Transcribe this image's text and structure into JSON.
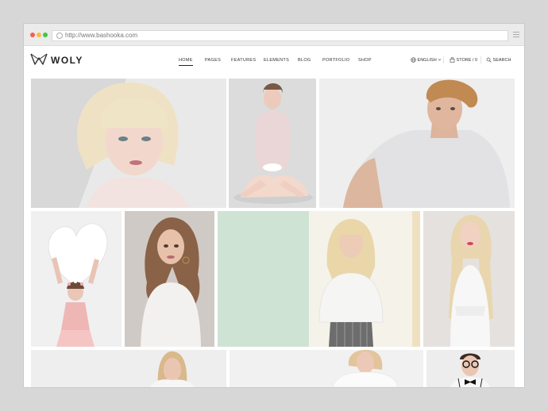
{
  "browser": {
    "url": "http://www.bashooka.com",
    "dot_colors": [
      "#f25f58",
      "#fbbd3c",
      "#3fc84a"
    ],
    "menu_icon": "hamburger-icon"
  },
  "site": {
    "logo_text": "WOLY",
    "logo_icon": "woly-logo-icon",
    "nav": [
      "HOME",
      "PAGES",
      "FEATURES",
      "ELEMENTS",
      "BLOG",
      "PORTFOLIO",
      "SHOP"
    ],
    "active_nav": "HOME",
    "language": "ENGLISH",
    "store": "STORE / 0",
    "search": "SEARCH"
  },
  "gallery": {
    "photos": [
      {
        "subject": "blonde-bob-portrait",
        "bg": "#e9e9e9"
      },
      {
        "subject": "sitting-woman-cardigan",
        "bg": "#dcdcdc"
      },
      {
        "subject": "man-grey-tshirt",
        "bg": "#eeeeee"
      },
      {
        "subject": "girl-holding-heart",
        "bg": "#f0f0f0"
      },
      {
        "subject": "woman-wavy-hair-white",
        "bg": "#cfcac6"
      },
      {
        "subject": "woman-lace-top-mint-wall",
        "bg": "#cfe3d5"
      },
      {
        "subject": "blonde-white-dress",
        "bg": "#e5e1de"
      },
      {
        "subject": "woman-white-row3",
        "bg": "#eeeeee"
      },
      {
        "subject": "woman-white-tee-row3",
        "bg": "#f1f1f1"
      },
      {
        "subject": "glasses-bowtie-row3",
        "bg": "#ededed"
      }
    ]
  }
}
